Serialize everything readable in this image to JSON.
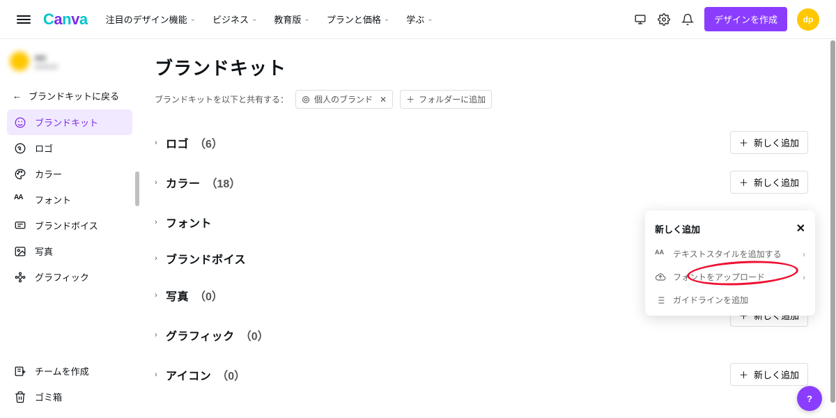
{
  "nav": {
    "items": [
      "注目のデザイン機能",
      "ビジネス",
      "教育版",
      "プランと価格",
      "学ぶ"
    ]
  },
  "header": {
    "design_btn": "デザインを作成",
    "avatar_initials": "dp"
  },
  "account": {
    "name": "●●",
    "sub": "●●●●●"
  },
  "sidebar": {
    "back": "ブランドキットに戻る",
    "items": [
      "ブランドキット",
      "ロゴ",
      "カラー",
      "フォント",
      "ブランドボイス",
      "写真",
      "グラフィック"
    ],
    "team": "チームを作成",
    "trash": "ゴミ箱"
  },
  "page": {
    "title": "ブランドキット",
    "share_label": "ブランドキットを以下と共有する：",
    "share_chip": "個人のブランド",
    "add_folder": "フォルダーに追加"
  },
  "sections": [
    {
      "label": "ロゴ",
      "count": "（6）"
    },
    {
      "label": "カラー",
      "count": "（18）"
    },
    {
      "label": "フォント",
      "count": ""
    },
    {
      "label": "ブランドボイス",
      "count": ""
    },
    {
      "label": "写真",
      "count": "（0）"
    },
    {
      "label": "グラフィック",
      "count": "（0）"
    },
    {
      "label": "アイコン",
      "count": "（0）"
    }
  ],
  "add_label": "新しく追加",
  "popover": {
    "title": "新しく追加",
    "items": [
      "テキストスタイルを追加する",
      "フォントをアップロード",
      "ガイドラインを追加"
    ]
  },
  "help": "?"
}
